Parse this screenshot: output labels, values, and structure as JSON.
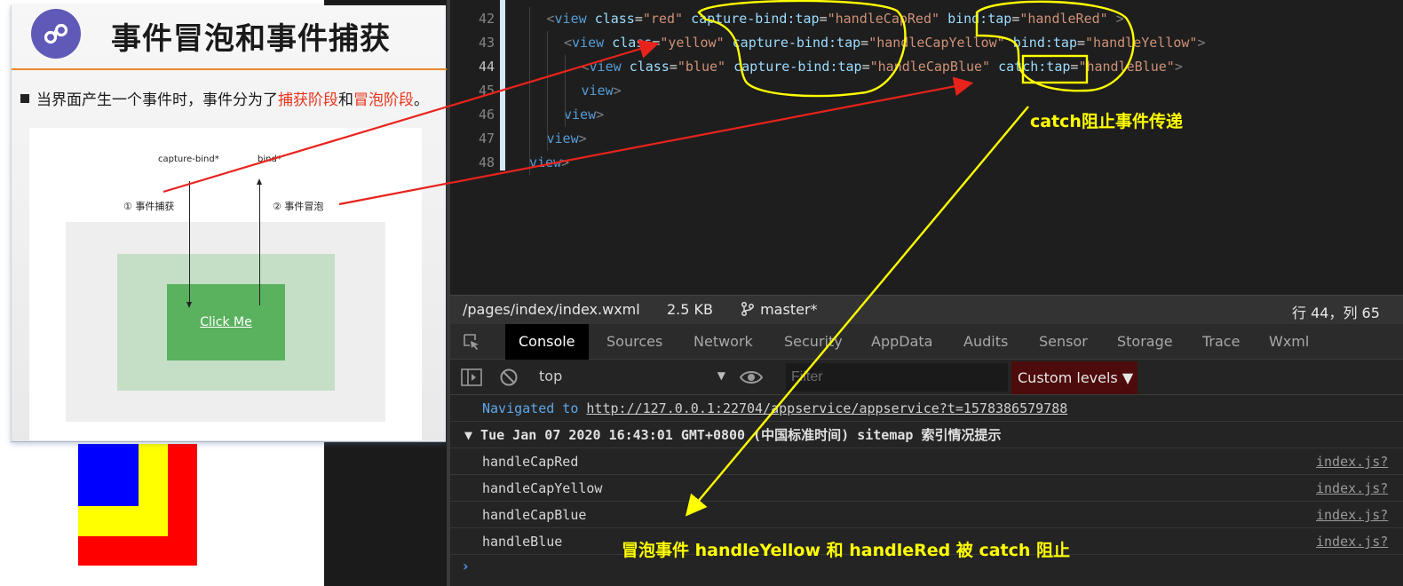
{
  "slide": {
    "title": "事件冒泡和事件捕获",
    "bullet_prefix": "当界面产生一个事件时，事件分为了",
    "bullet_capture": "捕获阶段",
    "bullet_and": "和",
    "bullet_bubble": "冒泡阶段",
    "bullet_end": "。",
    "diagram": {
      "capture_label": "capture-bind*",
      "bind_label": "bind*",
      "step_capture": "① 事件捕获",
      "step_bubble": "② 事件冒泡",
      "button_label": "Click Me"
    }
  },
  "editor": {
    "lines": [
      {
        "num": "42",
        "indent": 1,
        "tag": "view",
        "cls": "red",
        "cap": "handleCapRed",
        "bindKey": "bind:tap",
        "handler": "handleRed",
        "tail": " >"
      },
      {
        "num": "43",
        "indent": 2,
        "tag": "view",
        "cls": "yellow",
        "cap": "handleCapYellow",
        "bindKey": "bind:tap",
        "handler": "handleYellow",
        "tail": ">"
      },
      {
        "num": "44",
        "indent": 3,
        "tag": "view",
        "cls": "blue",
        "cap": "handleCapBlue",
        "bindKey": "catch:tap",
        "handler": "handleBlue",
        "tail": ">"
      },
      {
        "num": "45",
        "indent": 3,
        "close": "</view>"
      },
      {
        "num": "46",
        "indent": 2,
        "close": "</view>"
      },
      {
        "num": "47",
        "indent": 1,
        "close": "</view>"
      },
      {
        "num": "48",
        "indent": 0,
        "close": "</view>"
      }
    ],
    "active_line": "44"
  },
  "statusbar": {
    "path": "/pages/index/index.wxml",
    "size": "2.5 KB",
    "branch": "master*",
    "cursor": "行 44，列 65"
  },
  "devtools": {
    "tabs": [
      "Console",
      "Sources",
      "Network",
      "Security",
      "AppData",
      "Audits",
      "Sensor",
      "Storage",
      "Trace",
      "Wxml"
    ],
    "active_tab": "Console",
    "context": "top",
    "filter_placeholder": "Filter",
    "levels": "Custom levels ▼"
  },
  "console": {
    "navigated_prefix": "Navigated to",
    "navigated_url": "http://127.0.0.1:22704/appservice/appservice?t=1578386579788",
    "group": "▼ Tue Jan 07 2020 16:43:01 GMT+0800 (中国标准时间) sitemap 索引情况提示",
    "logs": [
      {
        "msg": "handleCapRed",
        "src": "index.js?"
      },
      {
        "msg": "handleCapYellow",
        "src": "index.js?"
      },
      {
        "msg": "handleCapBlue",
        "src": "index.js?"
      },
      {
        "msg": "handleBlue",
        "src": "index.js?"
      }
    ],
    "prompt": "›"
  },
  "annotations": {
    "catch_note": "catch阻止事件传递",
    "bubble_note": "冒泡事件 handleYellow 和 handleRed 被 catch 阻止"
  },
  "colors": {
    "box_red": "#ff0000",
    "box_yellow": "#ffff00",
    "box_blue": "#0000ff",
    "annotation_yellow": "#ffff00",
    "annotation_red": "#e8231c"
  }
}
